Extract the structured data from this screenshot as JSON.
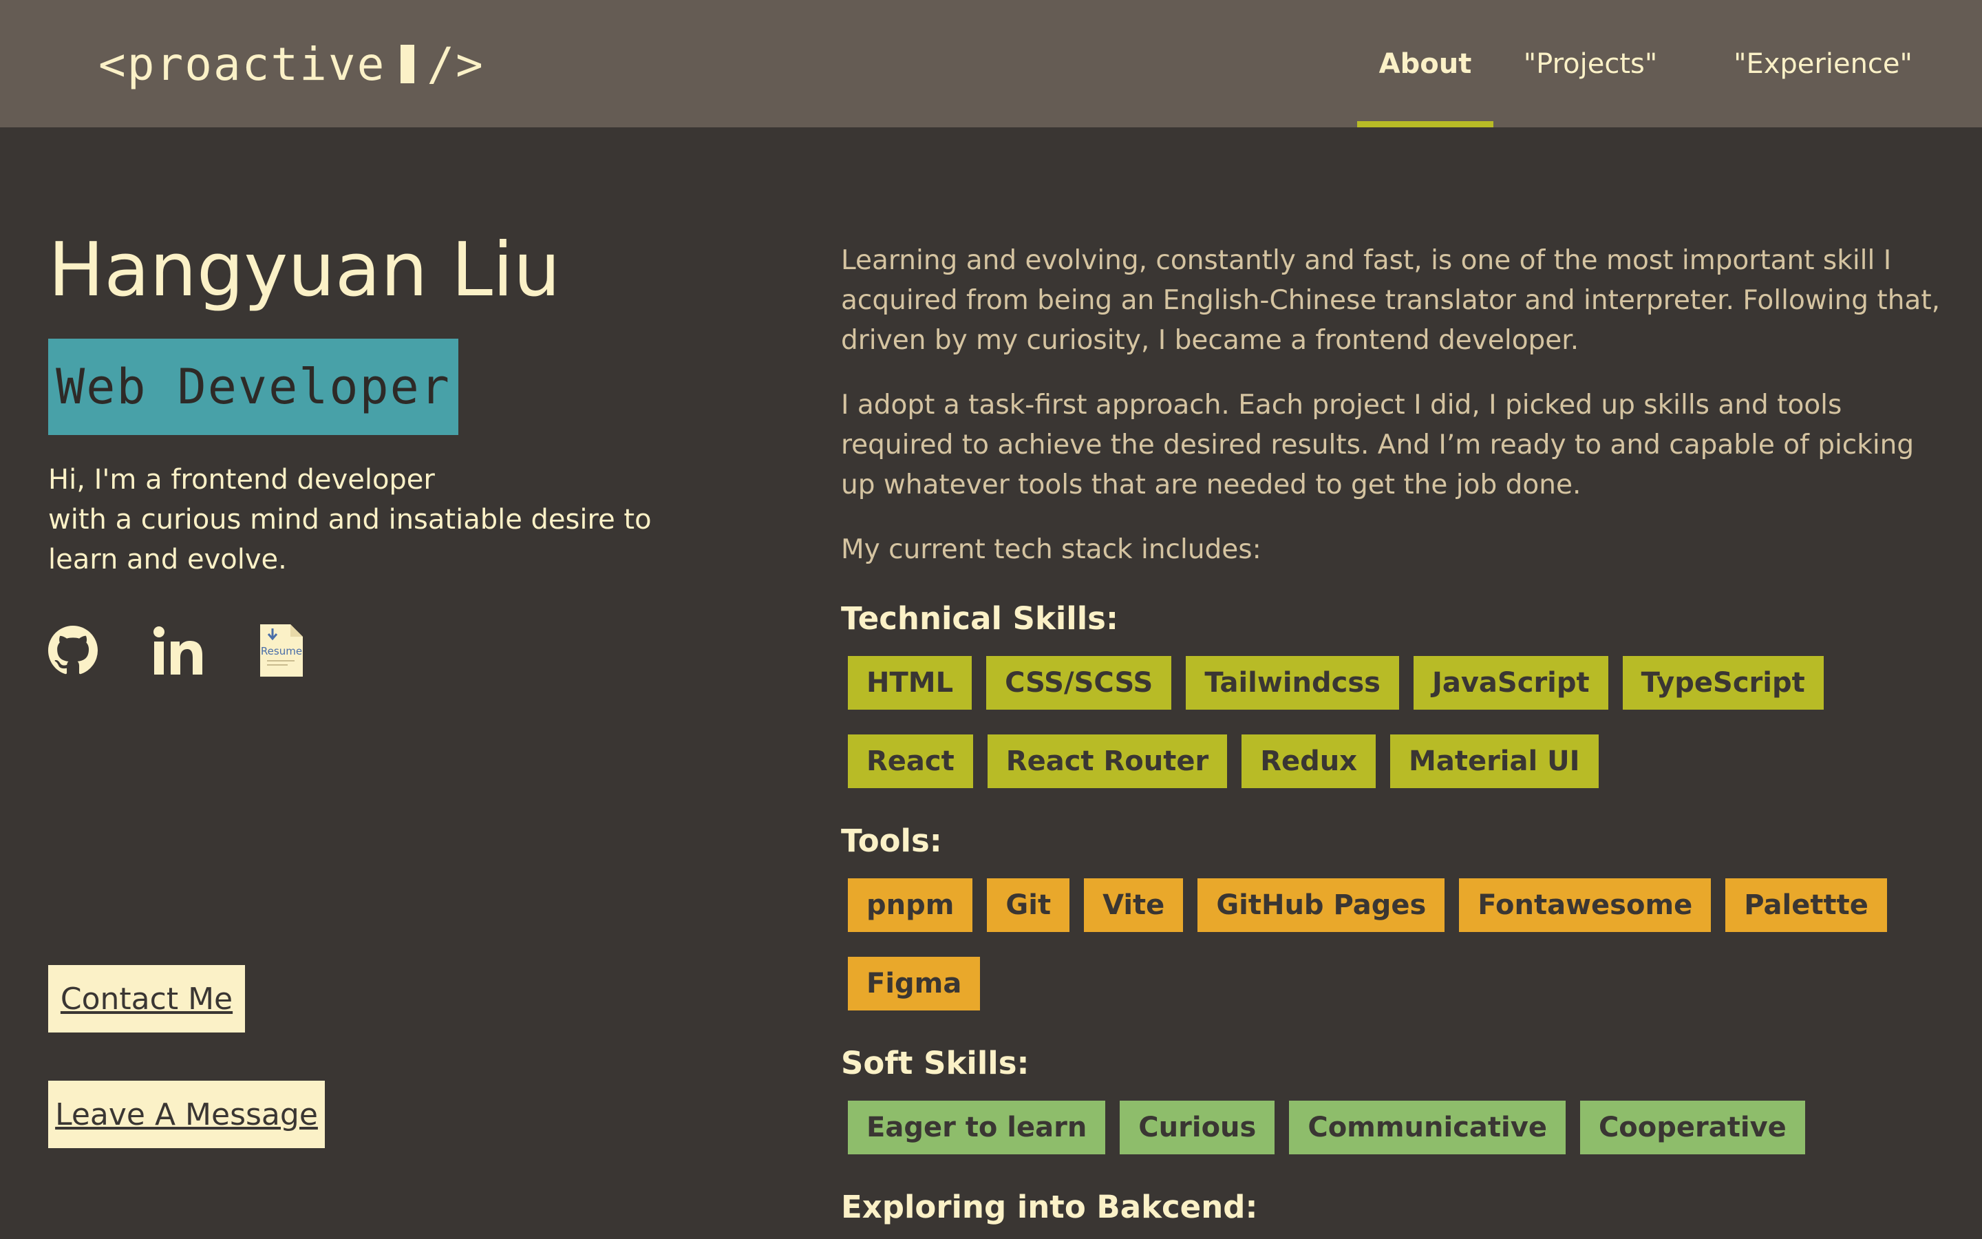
{
  "header": {
    "logo_text": "<proactive",
    "logo_tail": "/>",
    "nav": [
      {
        "label": "About",
        "active": true
      },
      {
        "label": "\"Projects\"",
        "active": false
      },
      {
        "label": "\"Experience\"",
        "active": false
      }
    ]
  },
  "profile": {
    "name": "Hangyuan Liu",
    "role": "Web Developer",
    "intro_line1": "Hi, I'm a frontend developer",
    "intro_line2": "with a curious mind and insatiable desire to learn and evolve.",
    "socials": [
      {
        "icon": "github-icon"
      },
      {
        "icon": "linkedin-icon"
      },
      {
        "icon": "resume-icon",
        "label": "Resume"
      }
    ],
    "contact_button": "Contact Me",
    "message_button": "Leave A Message"
  },
  "about": {
    "para1": "Learning and evolving, constantly and fast, is one of the most important skill I acquired from being an English-Chinese translator and interpreter. Following that, driven by my curiosity, I became a frontend developer.",
    "para2": "I adopt a task-first approach. Each project I did, I picked up skills and tools required to achieve the desired results. And I’m ready to and capable of picking up whatever tools that are needed to get the job done.",
    "para3": "My current tech stack includes:",
    "technical_title": "Technical Skills:",
    "technical": [
      "HTML",
      "CSS/SCSS",
      "Tailwindcss",
      "JavaScript",
      "TypeScript",
      "React",
      "React Router",
      "Redux",
      "Material UI"
    ],
    "tools_title": "Tools:",
    "tools": [
      "pnpm",
      "Git",
      "Vite",
      "GitHub Pages",
      "Fontawesome",
      "Palettte",
      "Figma"
    ],
    "soft_title": "Soft Skills:",
    "soft": [
      "Eager to learn",
      "Curious",
      "Communicative",
      "Cooperative"
    ],
    "backend_title": "Exploring into Bakcend:"
  },
  "colors": {
    "header_bg": "#655c54",
    "page_bg": "#3a3633",
    "accent_yellowgreen": "#b8bb26",
    "role_bg": "#48a1a8",
    "tool_tag": "#e9a82b",
    "soft_tag": "#8ebd6b",
    "cream": "#fbf1c7"
  }
}
